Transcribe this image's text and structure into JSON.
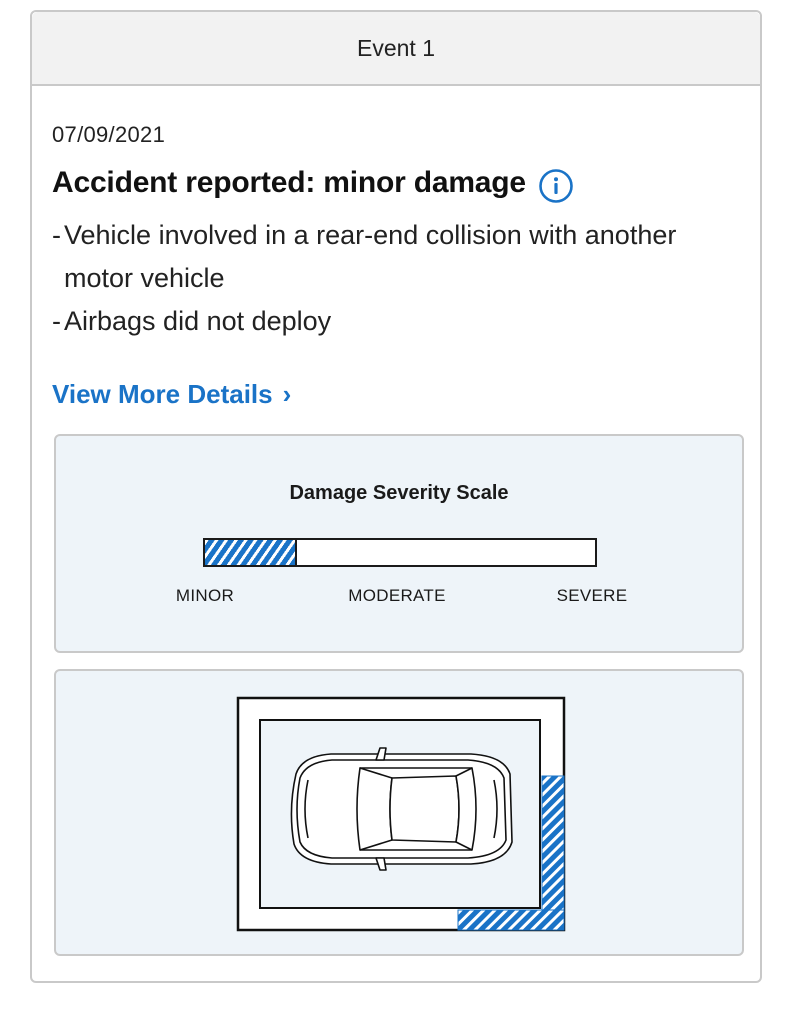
{
  "event": {
    "header": "Event 1",
    "date": "07/09/2021",
    "title": "Accident reported: minor damage",
    "details": [
      "Vehicle involved in a rear-end collision with another motor vehicle",
      "Airbags did not deploy"
    ],
    "view_more_label": "View More Details",
    "info_icon": "info-circle-icon",
    "chevron_icon": "chevron-right-icon"
  },
  "severity": {
    "title": "Damage Severity Scale",
    "level_fraction": 0.235,
    "labels": [
      "MINOR",
      "MODERATE",
      "SEVERE"
    ]
  },
  "colors": {
    "accent": "#1a73c7",
    "panel_bg": "#eef4f9",
    "header_bg": "#f2f2f2",
    "border": "#c9c9c9"
  },
  "damage_diagram": {
    "impact_area": "rear",
    "car_icon": "car-top-view-icon"
  }
}
